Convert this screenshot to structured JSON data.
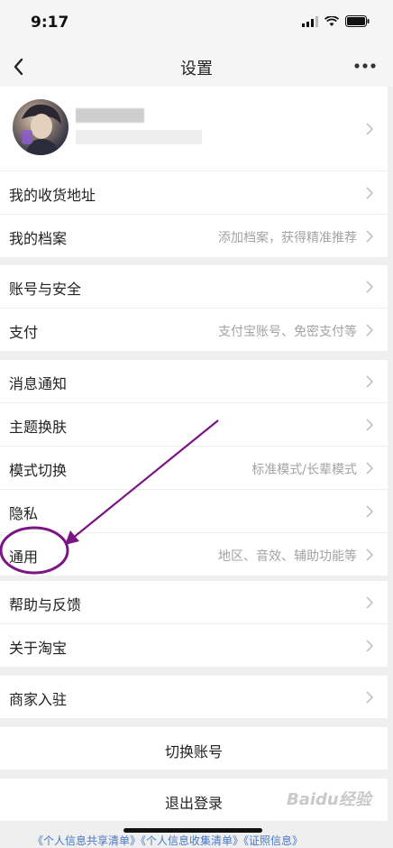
{
  "status_bar": {
    "time": "9:17"
  },
  "nav": {
    "title": "设置"
  },
  "groups": {
    "g1": [
      {
        "label": "我的收货地址",
        "hint": ""
      },
      {
        "label": "我的档案",
        "hint": "添加档案，获得精准推荐"
      }
    ],
    "g2": [
      {
        "label": "账号与安全",
        "hint": ""
      },
      {
        "label": "支付",
        "hint": "支付宝账号、免密支付等"
      }
    ],
    "g3": [
      {
        "label": "消息通知",
        "hint": ""
      },
      {
        "label": "主题换肤",
        "hint": ""
      },
      {
        "label": "模式切换",
        "hint": "标准模式/长辈模式"
      },
      {
        "label": "隐私",
        "hint": ""
      },
      {
        "label": "通用",
        "hint": "地区、音效、辅助功能等"
      }
    ],
    "g4": [
      {
        "label": "帮助与反馈",
        "hint": ""
      },
      {
        "label": "关于淘宝",
        "hint": ""
      }
    ],
    "g5": [
      {
        "label": "商家入驻",
        "hint": ""
      }
    ]
  },
  "actions": {
    "switch_account": "切换账号",
    "logout": "退出登录"
  },
  "footer_links": "《个人信息共享清单》《个人信息收集清单》《证照信息》",
  "watermark": "Baidu经验",
  "colors": {
    "annotation": "#7b1485",
    "hint": "#a3a3a3",
    "link": "#4a78c2"
  }
}
